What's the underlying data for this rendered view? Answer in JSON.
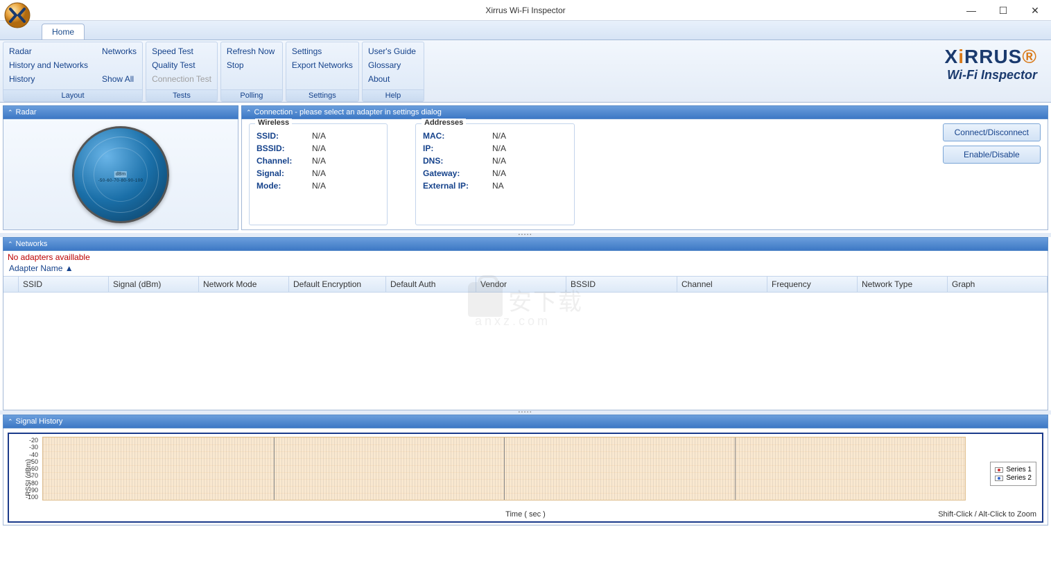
{
  "window": {
    "title": "Xirrus Wi-Fi Inspector"
  },
  "tabs": {
    "home": "Home"
  },
  "ribbon": {
    "layout": {
      "label": "Layout",
      "radar": "Radar",
      "history_networks": "History and Networks",
      "history": "History",
      "networks": "Networks",
      "show_all": "Show All"
    },
    "tests": {
      "label": "Tests",
      "speed": "Speed Test",
      "quality": "Quality Test",
      "connection": "Connection Test"
    },
    "polling": {
      "label": "Polling",
      "refresh": "Refresh Now",
      "stop": "Stop"
    },
    "settings": {
      "label": "Settings",
      "settings": "Settings",
      "export": "Export Networks"
    },
    "help": {
      "label": "Help",
      "guide": "User's Guide",
      "glossary": "Glossary",
      "about": "About"
    }
  },
  "brand": {
    "name": "XIRRUS",
    "sub": "Wi-Fi Inspector"
  },
  "panels": {
    "radar": {
      "title": "Radar",
      "center": "dBm",
      "scale": "-50-60-70-80-90-100"
    },
    "connection": {
      "title": "Connection - please select an adapter in settings dialog",
      "wireless_legend": "Wireless",
      "addresses_legend": "Addresses",
      "wireless": {
        "ssid_k": "SSID:",
        "ssid_v": "N/A",
        "bssid_k": "BSSID:",
        "bssid_v": "N/A",
        "channel_k": "Channel:",
        "channel_v": "N/A",
        "signal_k": "Signal:",
        "signal_v": "N/A",
        "mode_k": "Mode:",
        "mode_v": "N/A"
      },
      "addresses": {
        "mac_k": "MAC:",
        "mac_v": "N/A",
        "ip_k": "IP:",
        "ip_v": "N/A",
        "dns_k": "DNS:",
        "dns_v": "N/A",
        "gateway_k": "Gateway:",
        "gateway_v": "N/A",
        "ext_k": "External IP:",
        "ext_v": "NA"
      },
      "btn_connect": "Connect/Disconnect",
      "btn_enable": "Enable/Disable"
    },
    "networks": {
      "title": "Networks",
      "no_adapters": "No adapters availlable",
      "adapter_name": "Adapter Name ▲",
      "columns": [
        "SSID",
        "Signal (dBm)",
        "Network Mode",
        "Default Encryption",
        "Default Auth",
        "Vendor",
        "BSSID",
        "Channel",
        "Frequency",
        "Network Type",
        "Graph"
      ]
    },
    "signal": {
      "title": "Signal History",
      "ylabel": "RSSI (dBm)",
      "xlabel": "Time ( sec )",
      "zoom_hint": "Shift-Click / Alt-Click to Zoom",
      "series1": "Series 1",
      "series2": "Series 2"
    }
  },
  "chart_data": {
    "type": "line",
    "title": "Signal History",
    "xlabel": "Time ( sec )",
    "ylabel": "RSSI (dBm)",
    "ylim": [
      -100,
      -20
    ],
    "yticks": [
      -20,
      -30,
      -40,
      -50,
      -60,
      -70,
      -80,
      -90,
      -100
    ],
    "series": [
      {
        "name": "Series 1",
        "values": []
      },
      {
        "name": "Series 2",
        "values": []
      }
    ]
  }
}
